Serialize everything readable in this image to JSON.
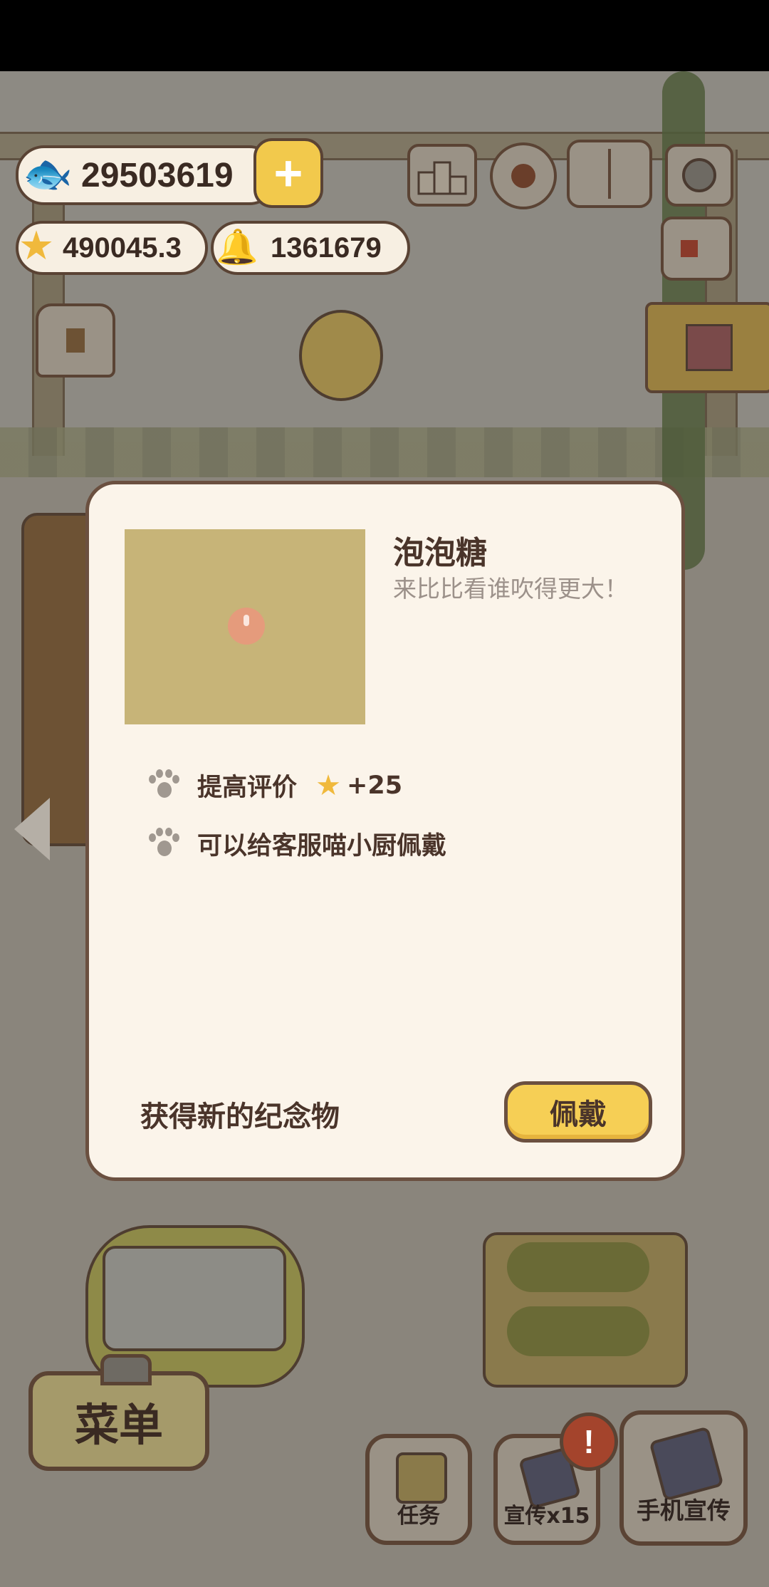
{
  "currency": {
    "fish": "29503619",
    "stars": "490045.3",
    "bells": "1361679"
  },
  "top_icons": [
    "ranking-icon",
    "settings-gear-icon",
    "paw-book-icon",
    "camera-icon",
    "newspaper-icon",
    "shop-icon",
    "playground-sign-icon"
  ],
  "dialog": {
    "title": "泡泡糖",
    "subtitle": "来比比看谁吹得更大！",
    "features": [
      {
        "text": "提高评价",
        "bonus": "+25"
      },
      {
        "text": "可以给客服喵小厨佩戴"
      }
    ],
    "footer_label": "获得新的纪念物",
    "wear_button": "佩戴"
  },
  "bottom_bar": {
    "menu": "菜单",
    "tasks": "任务",
    "promote": "宣传x15",
    "phone_promote": "手机宣传",
    "alert": "!"
  },
  "colors": {
    "accent_yellow": "#f6cf55",
    "dialog_bg": "#fbf4ea",
    "border_brown": "#6b5040",
    "alert_red": "#a4442c"
  }
}
